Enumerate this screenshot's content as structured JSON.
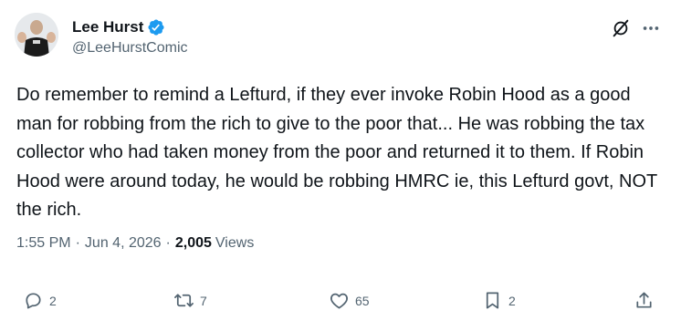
{
  "author": {
    "name": "Lee Hurst",
    "handle": "@LeeHurstComic"
  },
  "tweet": {
    "text": "Do remember to remind a Lefturd, if they ever invoke Robin Hood as a good man for robbing from the rich to give to the poor that... He was robbing the tax collector who had taken money from the poor and returned it to them. If Robin Hood were around today, he would be robbing HMRC ie, this Lefturd govt, NOT the rich.",
    "time": "1:55 PM",
    "date": "Jun 4, 2026",
    "separator": "·",
    "views_count": "2,005",
    "views_label": "Views"
  },
  "actions": {
    "replies": "2",
    "reposts": "7",
    "likes": "65",
    "bookmarks": "2"
  },
  "icons": [
    "verified-badge-icon",
    "grok-icon",
    "more-icon",
    "reply-icon",
    "repost-icon",
    "like-icon",
    "bookmark-icon",
    "share-icon"
  ],
  "colors": {
    "verified": "#1d9bf0",
    "text": "#0f1419",
    "secondary": "#536471"
  }
}
